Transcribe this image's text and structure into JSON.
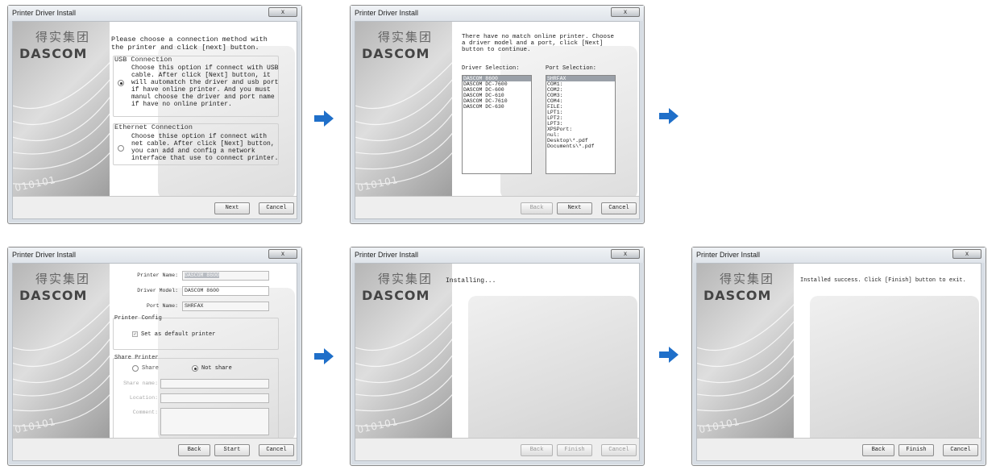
{
  "window_title": "Printer Driver Install",
  "close_glyph": "x",
  "logo": {
    "chinese": "得实集团",
    "english": "DASCOM",
    "binary": "010101"
  },
  "arrow_color": "#1f6fc9",
  "panel1": {
    "heading": "Please choose a connection method with\nthe printer and click [next] button.",
    "usb_title": "USB Connection",
    "usb_desc": "Choose this option if connect with USB\ncable. After click [Next] button, it\nwill automatch the driver and usb port\nif have online printer. And you must\nmanul choose the driver and port name\nif have no online printer.",
    "eth_title": "Ethernet Connection",
    "eth_desc": "Choose thise option if connect with\nnet cable. After click [Next] button,\nyou can add and config a network\ninterface that use to connect printer.",
    "next": "Next",
    "cancel": "Cancel"
  },
  "panel2": {
    "message": "There have no match online printer. Choose\na driver model and a port, click [Next]\nbutton to continue.",
    "driver_label": "Driver Selection:",
    "port_label": "Port Selection:",
    "drivers": [
      "DASCOM 8600",
      "DASCOM DC-7600",
      "DASCOM DC-600",
      "DASCOM DC-610",
      "DASCOM DC-7610",
      "DASCOM DC-630"
    ],
    "ports": [
      "SHRFAX",
      "COM1:",
      "COM2:",
      "COM3:",
      "COM4:",
      "FILE:",
      "LPT1:",
      "LPT2:",
      "LPT3:",
      "XPSPort:",
      "nul:",
      "Desktop\\*.pdf",
      "Documents\\*.pdf"
    ],
    "back": "Back",
    "next": "Next",
    "cancel": "Cancel"
  },
  "panel3": {
    "printer_name_label": "Printer Name:",
    "printer_name_value": "DASCOM 8600",
    "driver_model_label": "Driver Model:",
    "driver_model_value": "DASCOM 8600",
    "port_name_label": "Port Name:",
    "port_name_value": "SHRFAX",
    "config_title": "Printer Config",
    "default_label": "Set as default printer",
    "share_title": "Share Printer",
    "share_label": "Share",
    "not_share_label": "Not share",
    "share_name_label": "Share name:",
    "location_label": "Location:",
    "comment_label": "Comment:",
    "back": "Back",
    "start": "Start",
    "cancel": "Cancel"
  },
  "panel4": {
    "status": "Installing...",
    "back": "Back",
    "finish": "Finish",
    "cancel": "Cancel"
  },
  "panel5": {
    "status": "Installed success. Click [Finish] button to exit.",
    "back": "Back",
    "finish": "Finish",
    "cancel": "Cancel"
  }
}
